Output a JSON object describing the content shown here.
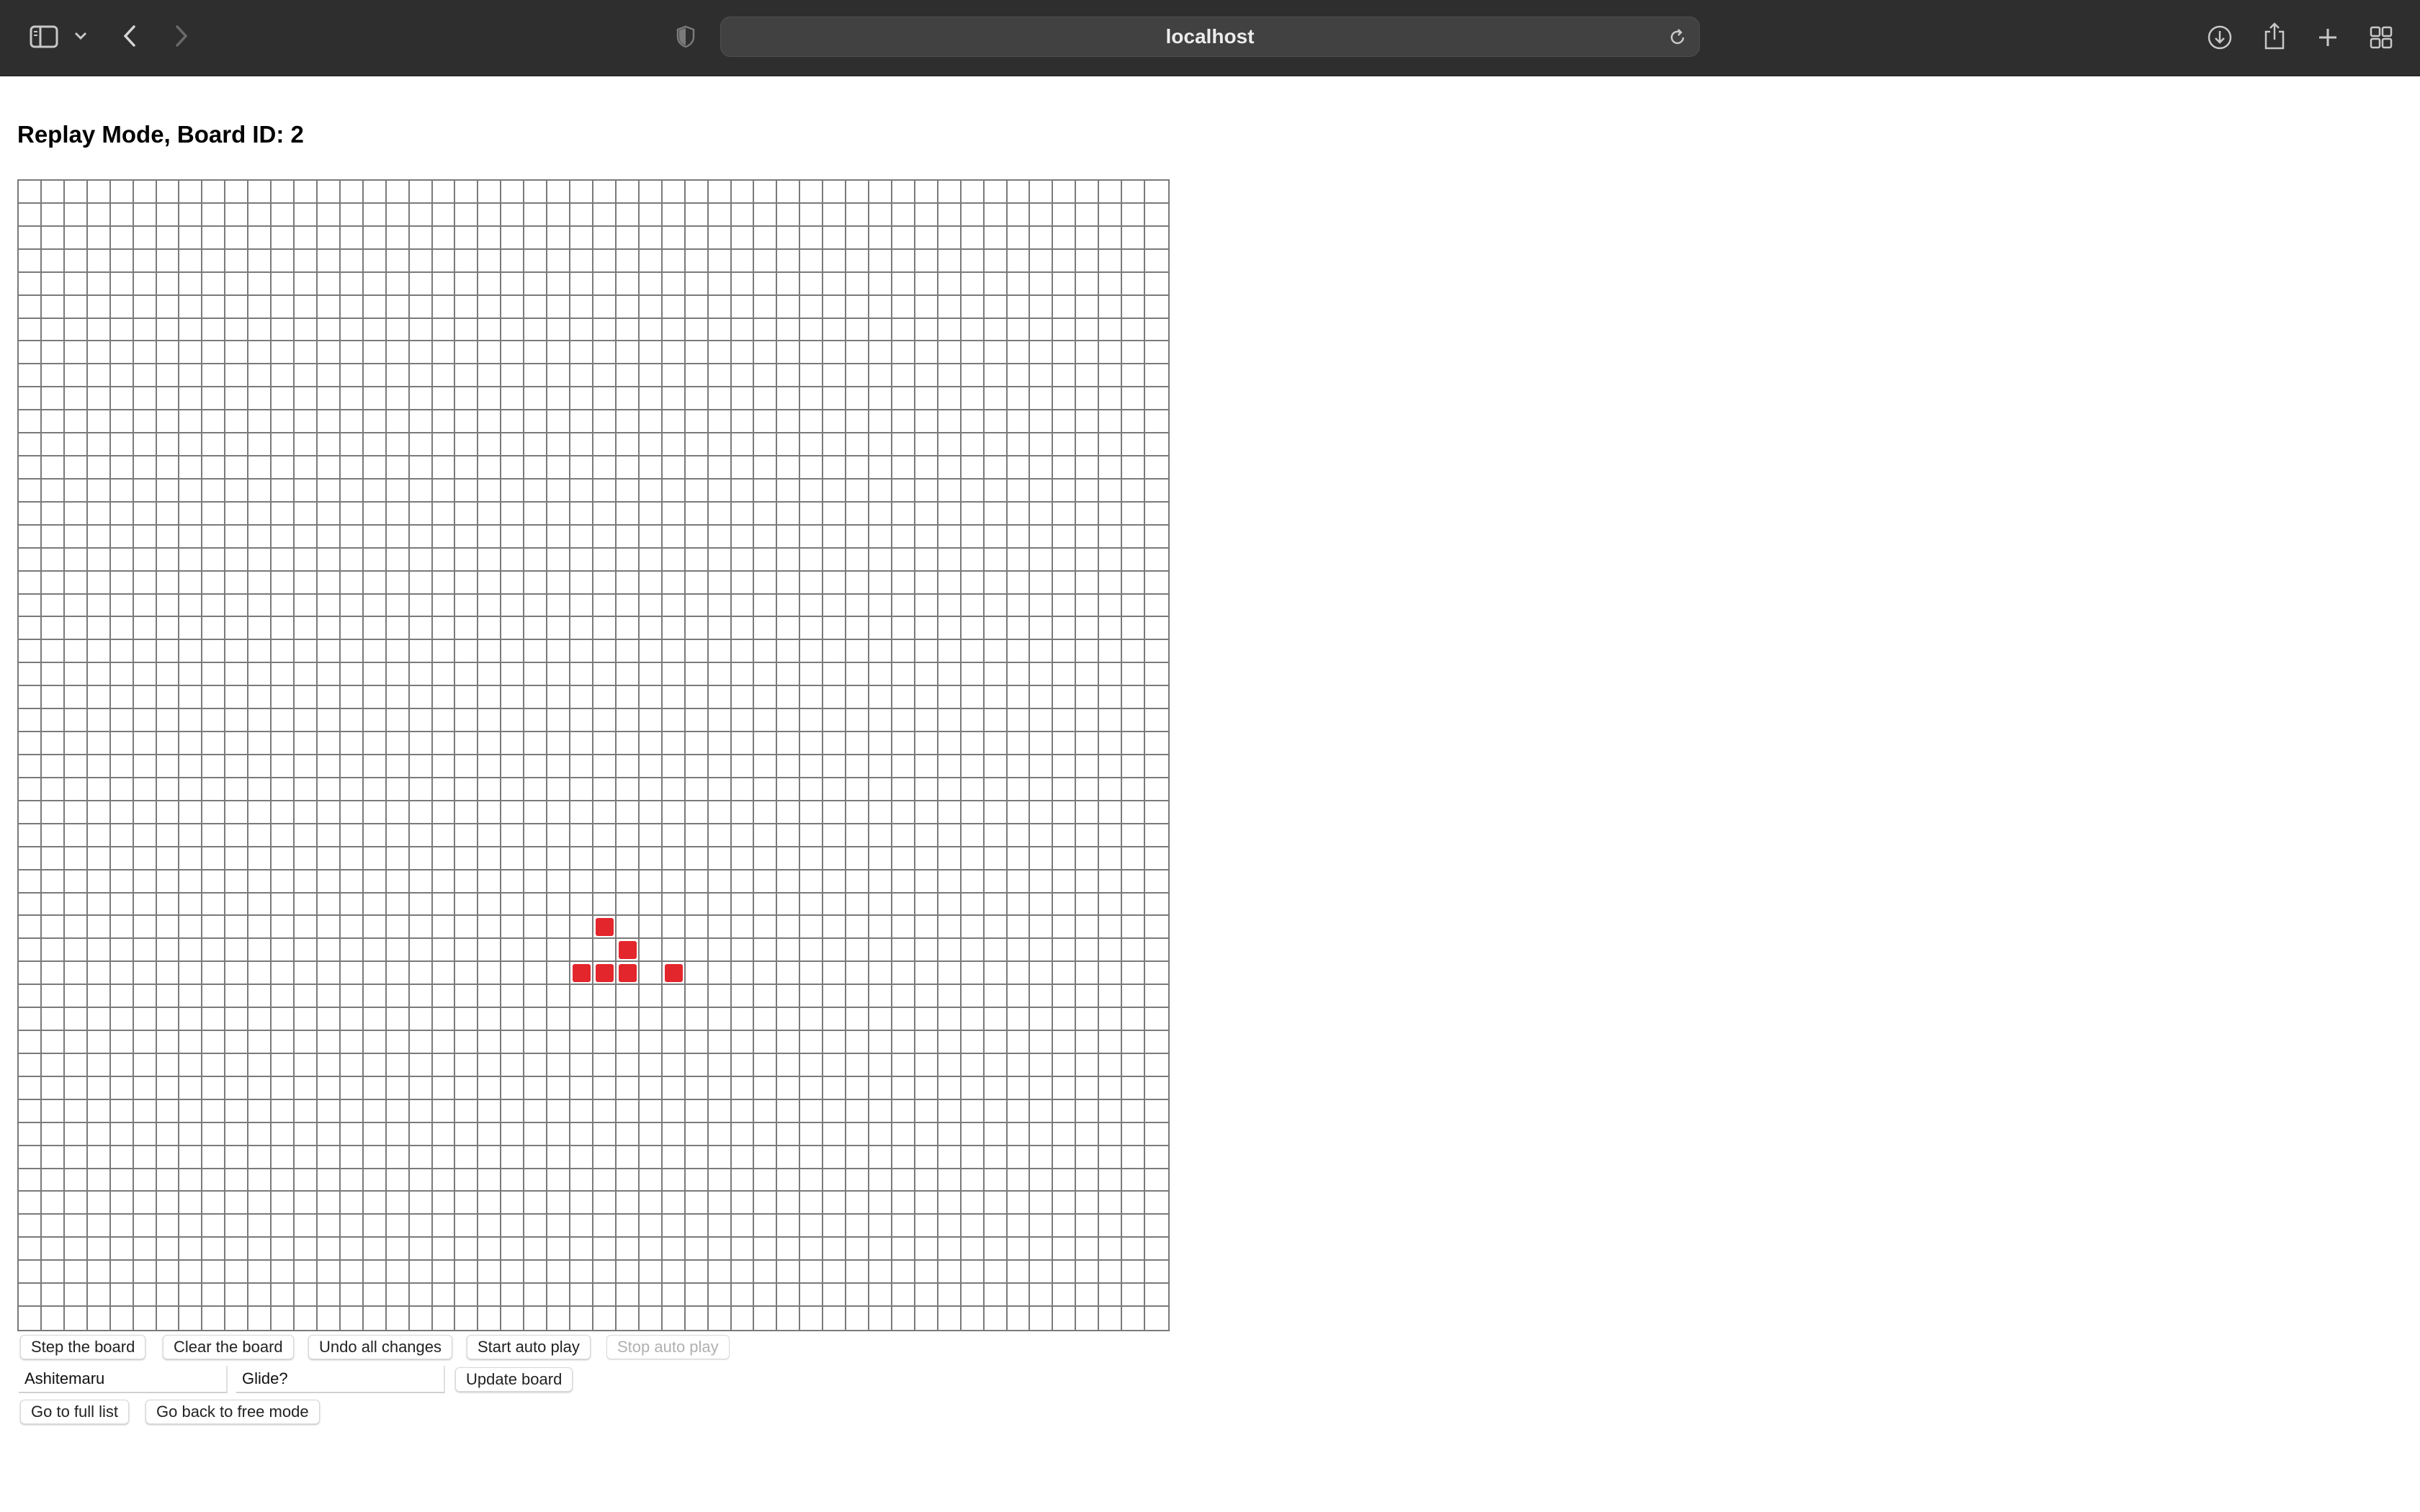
{
  "browser": {
    "url": "localhost"
  },
  "page": {
    "title": "Replay Mode, Board ID: 2"
  },
  "board": {
    "rows": 50,
    "cols": 50,
    "alive_color": "#e3262c",
    "alive_cells": [
      [
        32,
        25
      ],
      [
        33,
        26
      ],
      [
        34,
        24
      ],
      [
        34,
        25
      ],
      [
        34,
        26
      ],
      [
        34,
        28
      ]
    ]
  },
  "controls": {
    "step_label": "Step the board",
    "clear_label": "Clear the board",
    "undo_label": "Undo all changes",
    "start_auto_label": "Start auto play",
    "stop_auto_label": "Stop auto play",
    "name_value": "Ashitemaru",
    "description_value": "Glide?",
    "update_label": "Update board",
    "full_list_label": "Go to full list",
    "free_mode_label": "Go back to free mode"
  }
}
